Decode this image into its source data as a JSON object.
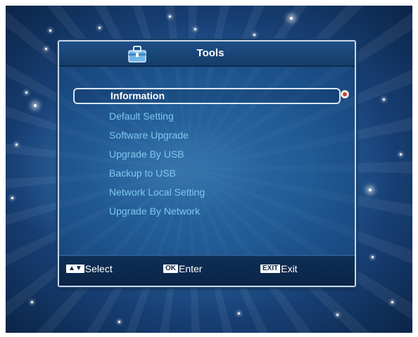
{
  "window": {
    "title": "Tools"
  },
  "menu": {
    "items": [
      {
        "label": "Information",
        "selected": true
      },
      {
        "label": "Default Setting"
      },
      {
        "label": "Software Upgrade"
      },
      {
        "label": "Upgrade By USB"
      },
      {
        "label": "Backup to USB"
      },
      {
        "label": "Network Local Setting"
      },
      {
        "label": "Upgrade By Network"
      }
    ]
  },
  "footer": {
    "select": {
      "key": "▲▼",
      "label": "Select"
    },
    "enter": {
      "key": "OK",
      "label": "Enter"
    },
    "exit": {
      "key": "EXIT",
      "label": "Exit"
    }
  },
  "colors": {
    "accent_text": "#7ec7ee",
    "selected_text": "#ffffff",
    "panel_border": "#c7d8ea"
  },
  "icons": {
    "title_icon": "toolbox-icon",
    "selection_marker": "radio-dot-icon"
  }
}
